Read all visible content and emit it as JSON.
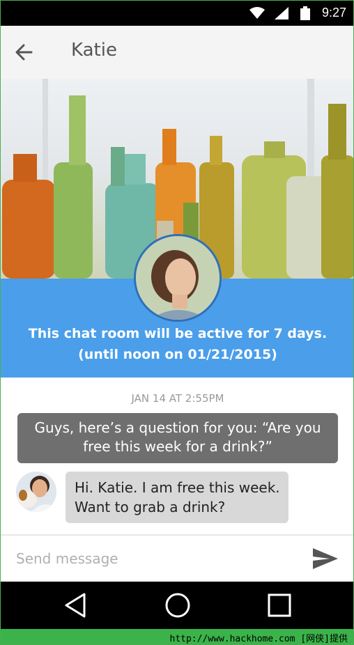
{
  "status_bar": {
    "time": "9:27"
  },
  "app_bar": {
    "title": "Katie"
  },
  "info_band": {
    "line1": "This chat room will be active for 7 days.",
    "line2": "(until noon on 01/21/2015)"
  },
  "chat": {
    "timestamp": "JAN 14 AT 2:55PM",
    "outgoing_line1": "Guys, here’s a question for you: “Are you",
    "outgoing_line2": "free this week for a drink?”",
    "incoming_line1": "Hi. Katie. I am free this week.",
    "incoming_line2": "Want to grab a drink?"
  },
  "composer": {
    "placeholder": "Send message"
  },
  "watermark": {
    "text": "http://www.hackhome.com [网侠]提供"
  },
  "colors": {
    "accent": "#4a9eea",
    "outgoing_bubble": "#6f6f6f",
    "incoming_bubble": "#d8d8d8"
  },
  "icons": [
    "wifi-icon",
    "signal-icon",
    "battery-icon",
    "back-arrow-icon",
    "send-icon",
    "nav-back-icon",
    "nav-home-icon",
    "nav-recents-icon"
  ]
}
